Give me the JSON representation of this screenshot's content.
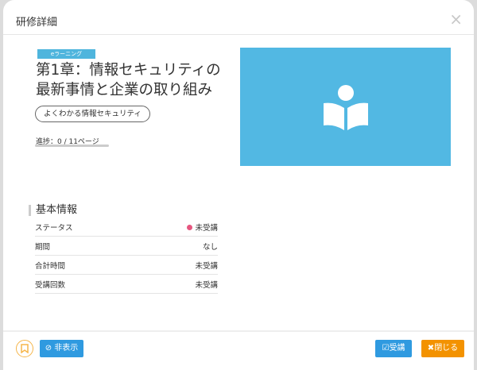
{
  "header": {
    "title": "研修詳細",
    "close": "×"
  },
  "course": {
    "badge": "eラーニング",
    "title": "第1章：情報セキュリティの最新事情と企業の取り組み",
    "tag": "よくわかる情報セキュリティ",
    "progress_text": "進捗：0 / 11ページ",
    "progress": 0,
    "image_color": "#52b8e3"
  },
  "info": {
    "heading": "基本情報",
    "rows": [
      {
        "label": "ステータス",
        "value": "未受講",
        "status_color": "#e6567f"
      },
      {
        "label": "期間",
        "value": "なし"
      },
      {
        "label": "合計時間",
        "value": "未受講"
      },
      {
        "label": "受講回数",
        "value": "未受講"
      }
    ]
  },
  "footer": {
    "hide": "非表示",
    "attend": "受講",
    "close": "閉じる"
  }
}
